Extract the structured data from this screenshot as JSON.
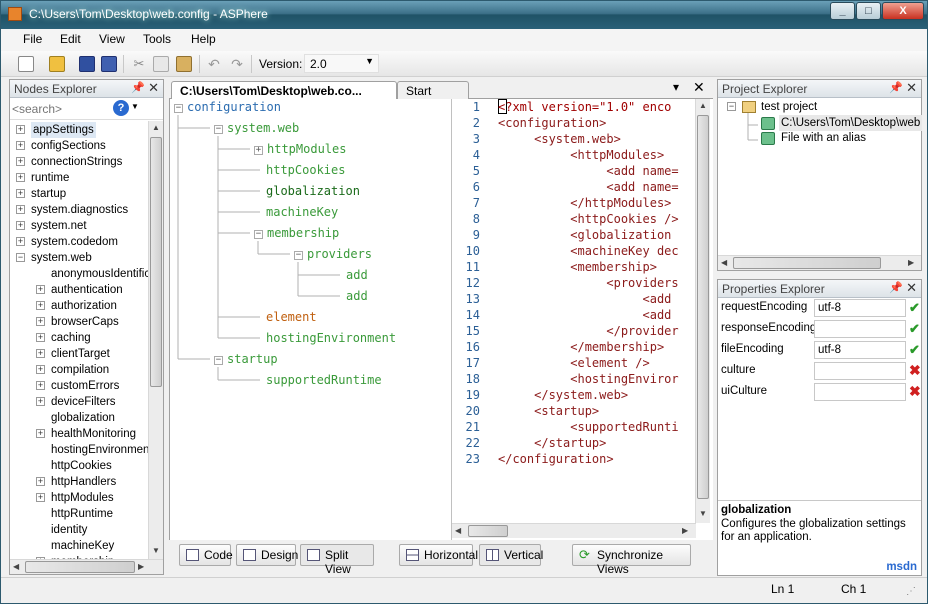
{
  "window": {
    "title": "C:\\Users\\Tom\\Desktop\\web.config - ASPhere",
    "minimize": "_",
    "maximize": "□",
    "close": "X"
  },
  "menu": [
    "File",
    "Edit",
    "View",
    "Tools",
    "Help"
  ],
  "toolbar": {
    "version_label": "Version:",
    "version_value": "2.0"
  },
  "nodes_explorer": {
    "title": "Nodes Explorer",
    "search_placeholder": "<search>",
    "items": [
      {
        "label": "appSettings",
        "expandable": true,
        "level": 0,
        "selected": true
      },
      {
        "label": "configSections",
        "expandable": true,
        "level": 0
      },
      {
        "label": "connectionStrings",
        "expandable": true,
        "level": 0
      },
      {
        "label": "runtime",
        "expandable": true,
        "level": 0
      },
      {
        "label": "startup",
        "expandable": true,
        "level": 0
      },
      {
        "label": "system.diagnostics",
        "expandable": true,
        "level": 0
      },
      {
        "label": "system.net",
        "expandable": true,
        "level": 0
      },
      {
        "label": "system.codedom",
        "expandable": true,
        "level": 0
      },
      {
        "label": "system.web",
        "expandable": true,
        "level": 0,
        "expanded": true
      },
      {
        "label": "anonymousIdentifica",
        "expandable": false,
        "level": 1
      },
      {
        "label": "authentication",
        "expandable": true,
        "level": 1
      },
      {
        "label": "authorization",
        "expandable": true,
        "level": 1
      },
      {
        "label": "browserCaps",
        "expandable": true,
        "level": 1
      },
      {
        "label": "caching",
        "expandable": true,
        "level": 1
      },
      {
        "label": "clientTarget",
        "expandable": true,
        "level": 1
      },
      {
        "label": "compilation",
        "expandable": true,
        "level": 1
      },
      {
        "label": "customErrors",
        "expandable": true,
        "level": 1
      },
      {
        "label": "deviceFilters",
        "expandable": true,
        "level": 1
      },
      {
        "label": "globalization",
        "expandable": false,
        "level": 1
      },
      {
        "label": "healthMonitoring",
        "expandable": true,
        "level": 1
      },
      {
        "label": "hostingEnvironment",
        "expandable": false,
        "level": 1
      },
      {
        "label": "httpCookies",
        "expandable": false,
        "level": 1
      },
      {
        "label": "httpHandlers",
        "expandable": true,
        "level": 1
      },
      {
        "label": "httpModules",
        "expandable": true,
        "level": 1
      },
      {
        "label": "httpRuntime",
        "expandable": false,
        "level": 1
      },
      {
        "label": "identity",
        "expandable": false,
        "level": 1
      },
      {
        "label": "machineKey",
        "expandable": false,
        "level": 1
      },
      {
        "label": "membership",
        "expandable": true,
        "level": 1
      }
    ]
  },
  "editor": {
    "tabs": [
      {
        "label": "C:\\Users\\Tom\\Desktop\\web.co...",
        "active": true
      },
      {
        "label": "Start Page",
        "active": false
      }
    ],
    "tree": [
      {
        "label": "configuration",
        "level": 0,
        "box": "minus",
        "color": "#2b6cb0"
      },
      {
        "label": "system.web",
        "level": 1,
        "box": "minus",
        "color": "#3a9a3a"
      },
      {
        "label": "httpModules",
        "level": 2,
        "box": "plus",
        "color": "#3a9a3a"
      },
      {
        "label": "httpCookies",
        "level": 2,
        "box": "",
        "color": "#3a9a3a"
      },
      {
        "label": "globalization",
        "level": 2,
        "box": "",
        "color": "#1a6a1a"
      },
      {
        "label": "machineKey",
        "level": 2,
        "box": "",
        "color": "#3a9a3a"
      },
      {
        "label": "membership",
        "level": 2,
        "box": "minus",
        "color": "#3a9a3a"
      },
      {
        "label": "providers",
        "level": 3,
        "box": "minus",
        "color": "#3a9a3a"
      },
      {
        "label": "add",
        "level": 4,
        "box": "",
        "color": "#3a9a3a"
      },
      {
        "label": "add",
        "level": 4,
        "box": "",
        "color": "#3a9a3a"
      },
      {
        "label": "element",
        "level": 2,
        "box": "",
        "color": "#c06010"
      },
      {
        "label": "hostingEnvironment",
        "level": 2,
        "box": "",
        "color": "#3a9a3a"
      },
      {
        "label": "startup",
        "level": 1,
        "box": "minus",
        "color": "#3a9a3a"
      },
      {
        "label": "supportedRuntime",
        "level": 2,
        "box": "",
        "color": "#3a9a3a"
      }
    ],
    "code_lines": [
      "<?xml version=\"1.0\" enco",
      "<configuration>",
      "     <system.web>",
      "          <httpModules>",
      "               <add name=",
      "               <add name=",
      "          </httpModules>",
      "          <httpCookies />",
      "          <globalization",
      "          <machineKey dec",
      "          <membership>",
      "               <providers",
      "                    <add",
      "                    <add",
      "               </provider",
      "          </membership>",
      "          <element />",
      "          <hostingEnviror",
      "     </system.web>",
      "     <startup>",
      "          <supportedRunti",
      "     </startup>",
      "</configuration>"
    ],
    "view_buttons": {
      "code": "Code",
      "design": "Design",
      "split": "Split View",
      "horizontal": "Horizontal",
      "vertical": "Vertical",
      "sync": "Synchronize Views"
    }
  },
  "project_explorer": {
    "title": "Project Explorer",
    "project": "test project",
    "files": [
      "C:\\Users\\Tom\\Desktop\\web",
      "File with an alias"
    ]
  },
  "properties_explorer": {
    "title": "Properties Explorer",
    "rows": [
      {
        "name": "requestEncoding",
        "value": "utf-8",
        "status": "ok"
      },
      {
        "name": "responseEncoding",
        "value": "",
        "status": "ok"
      },
      {
        "name": "fileEncoding",
        "value": "utf-8",
        "status": "ok"
      },
      {
        "name": "culture",
        "value": "",
        "status": "error"
      },
      {
        "name": "uiCulture",
        "value": "",
        "status": "error"
      }
    ],
    "help_title": "globalization",
    "help_text": "Configures the globalization settings for an application.",
    "help_link": "msdn"
  },
  "status": {
    "line": "Ln 1",
    "col": "Ch 1"
  }
}
